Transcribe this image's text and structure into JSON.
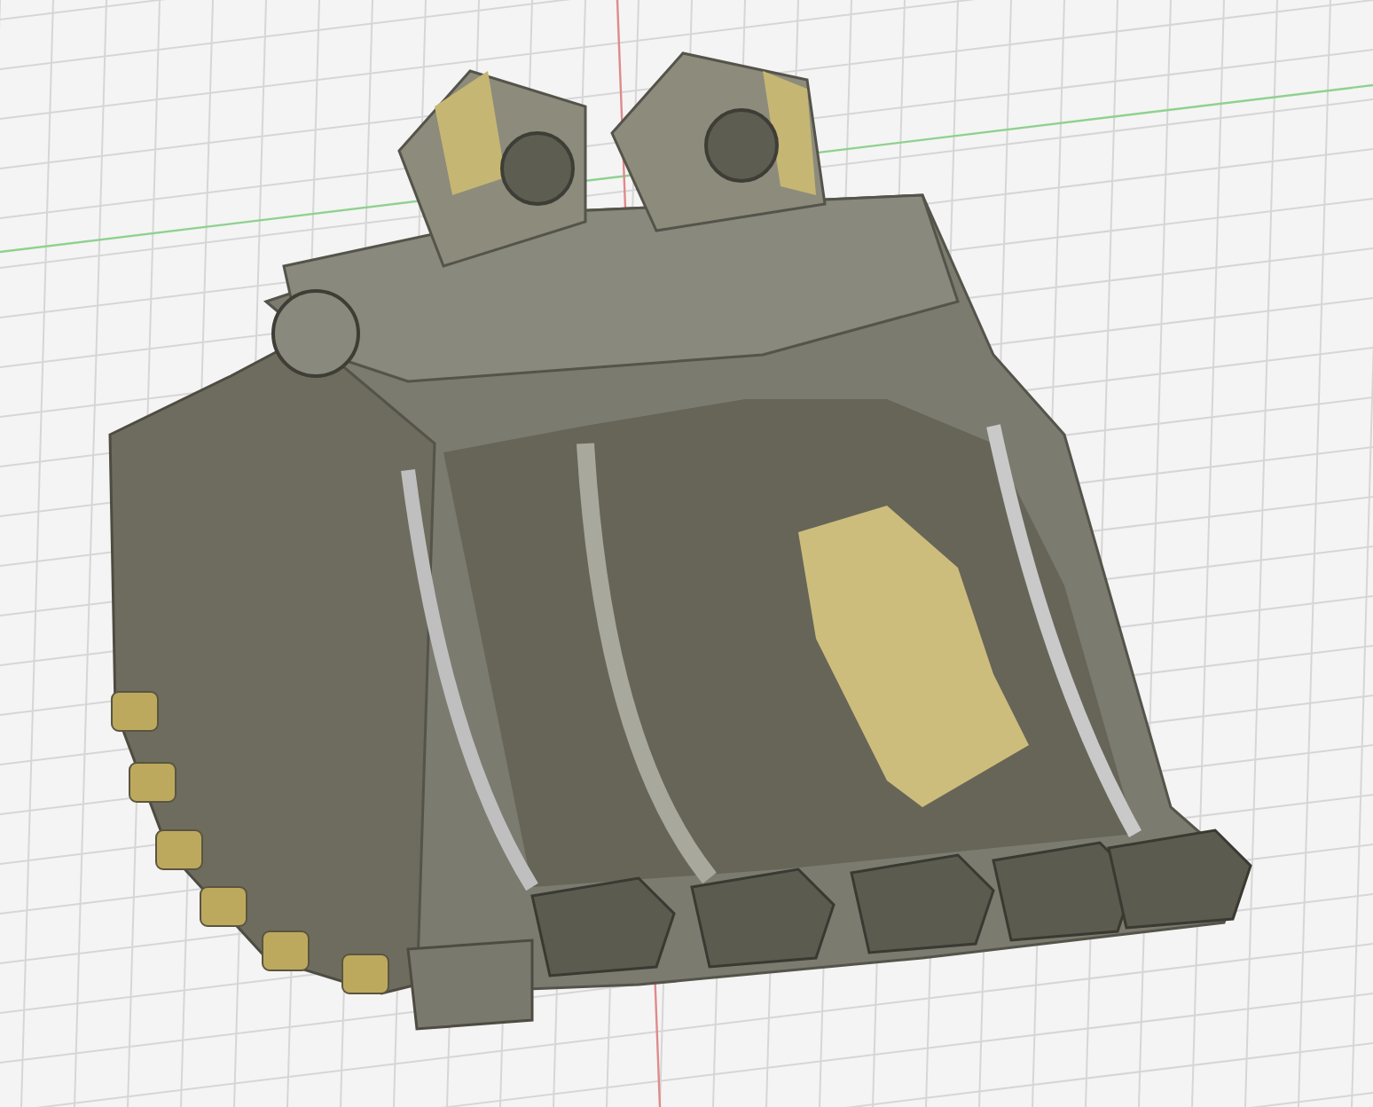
{
  "viewport": {
    "grid": true,
    "axes": true
  }
}
